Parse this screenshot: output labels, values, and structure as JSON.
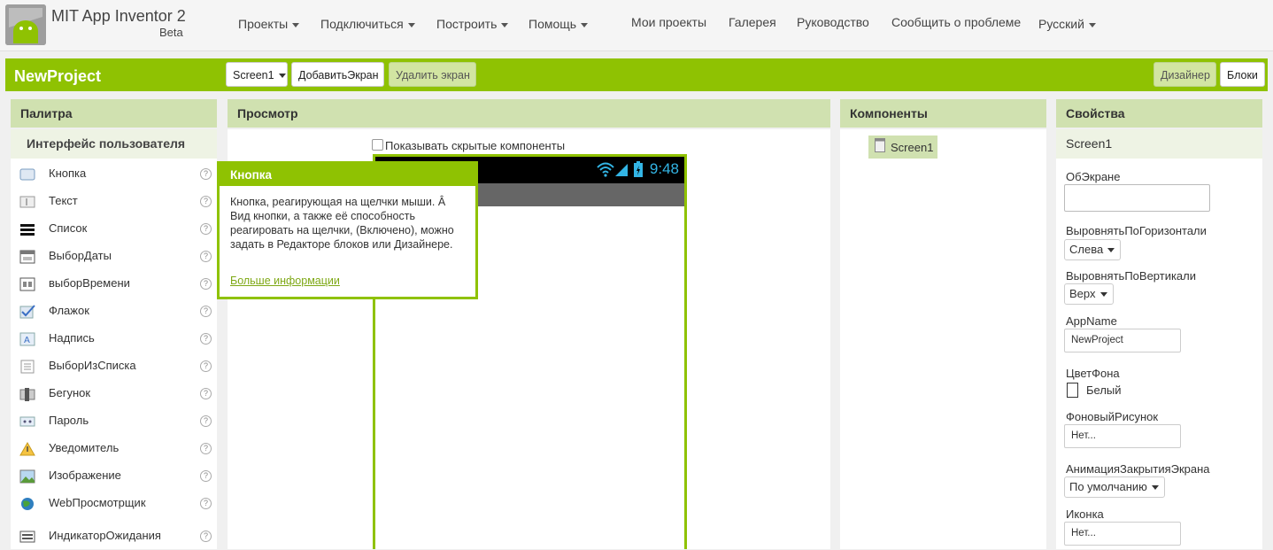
{
  "app": {
    "title": "MIT App Inventor 2",
    "subtitle": "Beta"
  },
  "topnav": {
    "menus": [
      "Проекты",
      "Подключиться",
      "Построить",
      "Помощь"
    ],
    "links": [
      "Мои проекты",
      "Галерея",
      "Руководство",
      "Сообщить о проблеме"
    ],
    "language": "Русский"
  },
  "toolbar": {
    "project_name": "NewProject",
    "screen_select": "Screen1",
    "add_screen": "ДобавитьЭкран",
    "remove_screen": "Удалить экран",
    "designer": "Дизайнер",
    "blocks": "Блоки"
  },
  "palette": {
    "header": "Палитра",
    "category": "Интерфейс пользователя",
    "items": [
      {
        "label": "Кнопка",
        "icon": "button-icon"
      },
      {
        "label": "Текст",
        "icon": "textbox-icon"
      },
      {
        "label": "Список",
        "icon": "listview-icon"
      },
      {
        "label": "ВыборДаты",
        "icon": "datepicker-icon"
      },
      {
        "label": "выборВремени",
        "icon": "timepicker-icon"
      },
      {
        "label": "Флажок",
        "icon": "checkbox-icon"
      },
      {
        "label": "Надпись",
        "icon": "label-icon"
      },
      {
        "label": "ВыборИзСписка",
        "icon": "listpicker-icon"
      },
      {
        "label": "Бегунок",
        "icon": "slider-icon"
      },
      {
        "label": "Пароль",
        "icon": "password-icon"
      },
      {
        "label": "Уведомитель",
        "icon": "notifier-icon"
      },
      {
        "label": "Изображение",
        "icon": "image-icon"
      },
      {
        "label": "WebПросмотрщик",
        "icon": "webviewer-icon"
      },
      {
        "label": "ИндикаторОжидания",
        "icon": "spinner-icon"
      }
    ],
    "help_glyph": "?"
  },
  "tooltip": {
    "title": "Кнопка",
    "text": "Кнопка, реагирующая на щелчки мыши. Â Вид кнопки, а также её способность реагировать на щелчки, (Включено), можно задать в Редакторе блоков или Дизайнере.",
    "link": "Больше информации"
  },
  "viewer": {
    "header": "Просмотр",
    "show_hidden": "Показывать скрытые компоненты",
    "phone_time": "9:48"
  },
  "components": {
    "header": "Компоненты",
    "tree": [
      "Screen1"
    ]
  },
  "properties": {
    "header": "Свойства",
    "component": "Screen1",
    "fields": {
      "about_screen": {
        "label": "ОбЭкране",
        "value": ""
      },
      "align_horizontal": {
        "label": "ВыровнятьПоГоризонтали",
        "value": "Слева"
      },
      "align_vertical": {
        "label": "ВыровнятьПоВертикали",
        "value": "Верх"
      },
      "app_name": {
        "label": "AppName",
        "value": "NewProject"
      },
      "background_color": {
        "label": "ЦветФона",
        "value": "Белый"
      },
      "background_image": {
        "label": "ФоновыйРисунок",
        "value": "Нет..."
      },
      "close_animation": {
        "label": "АнимацияЗакрытияЭкрана",
        "value": "По умолчанию"
      },
      "icon": {
        "label": "Иконка",
        "value": "Нет..."
      }
    }
  },
  "colors": {
    "accent": "#8fc202",
    "header_bg": "#d0e1b0",
    "phone_time": "#33b5e5"
  }
}
